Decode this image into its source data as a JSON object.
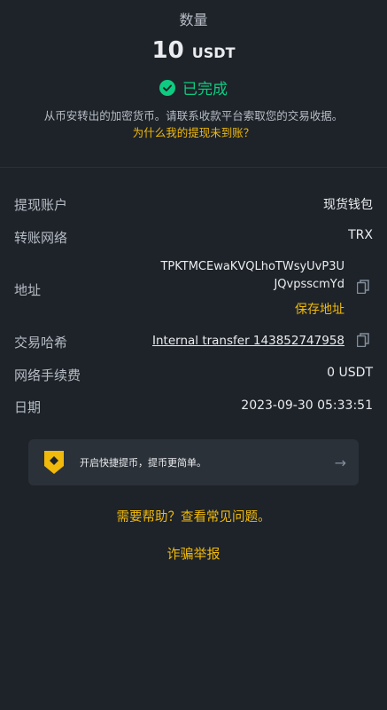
{
  "header": {
    "title": "数量",
    "amount": "10",
    "unit": "USDT",
    "status": "已完成",
    "description": "从币安转出的加密货币。请联系收款平台索取您的交易收据。",
    "help_link": "为什么我的提现未到账？"
  },
  "details": {
    "account_label": "提现账户",
    "account_value": "现货钱包",
    "network_label": "转账网络",
    "network_value": "TRX",
    "address_label": "地址",
    "address_line1": "TPKTMCEwaKVQLhoTWsyUvP3U",
    "address_line2": "JQvpsscmYd",
    "save_address": "保存地址",
    "txid_label": "交易哈希",
    "txid_value": "Internal transfer 143852747958",
    "fee_label": "网络手续费",
    "fee_value": "0 USDT",
    "date_label": "日期",
    "date_value": "2023-09-30 05:33:51"
  },
  "banner": {
    "text": "开启快捷提币，提币更简单。"
  },
  "footer": {
    "faq_link": "需要帮助？查看常见问题。",
    "fraud_link": "诈骗举报"
  },
  "colors": {
    "background": "#1e2329",
    "accent": "#f0b90b",
    "success": "#0ecb81",
    "card": "#2b3139"
  }
}
